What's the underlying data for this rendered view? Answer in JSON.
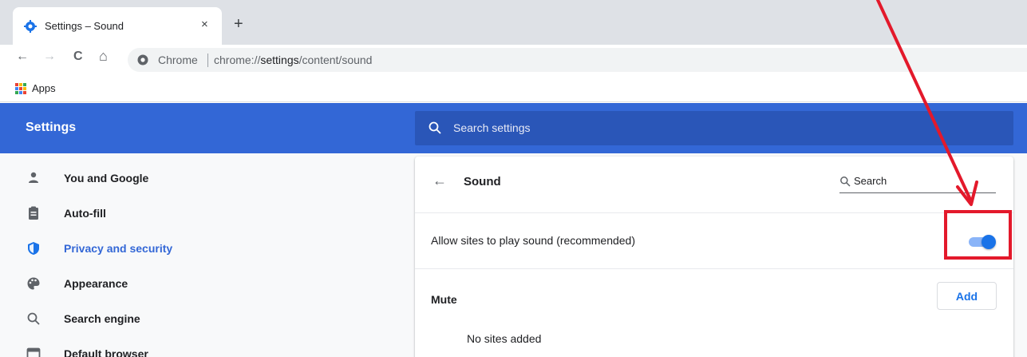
{
  "browser": {
    "tab": {
      "title": "Settings – Sound",
      "close": "×",
      "icon": "gear-icon"
    },
    "new_tab": "+",
    "toolbar": {
      "back": "←",
      "forward": "→",
      "reload": "C",
      "home": "⌂"
    },
    "omnibox": {
      "scheme_label": "Chrome",
      "url_prefix": "chrome://",
      "url_host": "settings",
      "url_path": "/content/sound"
    },
    "bookmarks": {
      "apps_label": "Apps"
    }
  },
  "header": {
    "title": "Settings",
    "search_placeholder": "Search settings"
  },
  "sidebar": {
    "items": [
      {
        "label": "You and Google",
        "icon": "person-icon",
        "active": false
      },
      {
        "label": "Auto-fill",
        "icon": "clipboard-icon",
        "active": false
      },
      {
        "label": "Privacy and security",
        "icon": "shield-icon",
        "active": true
      },
      {
        "label": "Appearance",
        "icon": "palette-icon",
        "active": false
      },
      {
        "label": "Search engine",
        "icon": "search-icon",
        "active": false
      },
      {
        "label": "Default browser",
        "icon": "browser-icon",
        "active": false
      }
    ]
  },
  "content": {
    "back": "←",
    "title": "Sound",
    "search_placeholder": "Search",
    "allow_label": "Allow sites to play sound (recommended)",
    "allow_enabled": true,
    "mute_label": "Mute",
    "add_label": "Add",
    "empty_text": "No sites added"
  },
  "colors": {
    "header_blue": "#3367d6",
    "accent": "#1a73e8",
    "annotation_red": "#e3192b"
  }
}
